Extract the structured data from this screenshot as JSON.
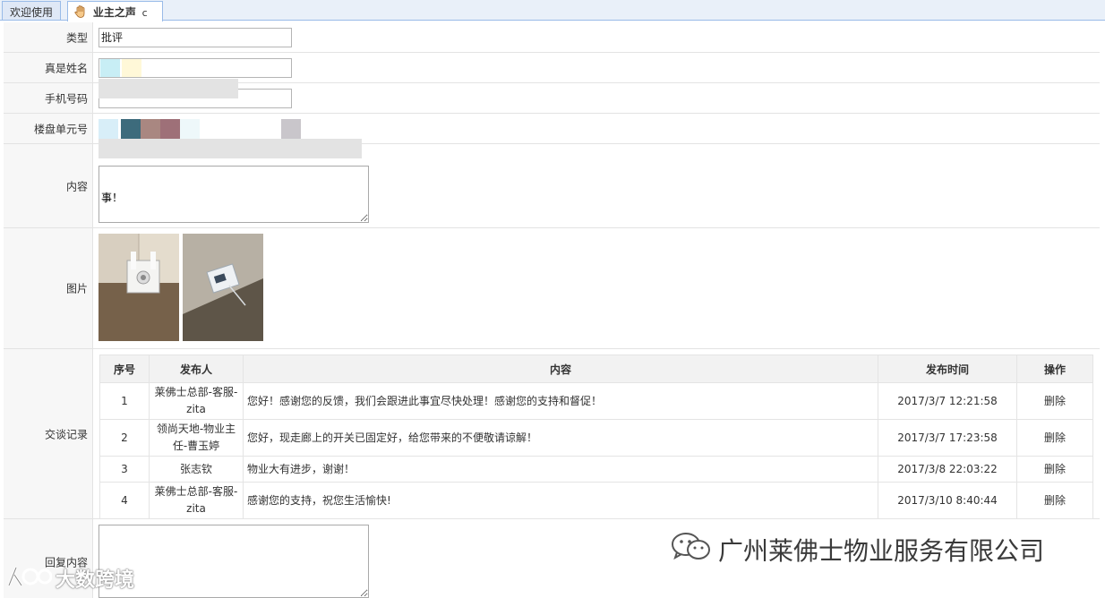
{
  "tabs": {
    "welcome": "欢迎使用",
    "current": "业主之声",
    "refresh": "c",
    "close": "×"
  },
  "form": {
    "type": {
      "label": "类型",
      "value": "批评"
    },
    "name": {
      "label": "真是姓名"
    },
    "phone": {
      "label": "手机号码"
    },
    "unit": {
      "label": "楼盘单元号"
    },
    "content": {
      "label": "内容",
      "value": "事！"
    },
    "images": {
      "label": "图片"
    },
    "records": {
      "label": "交谈记录"
    },
    "reply": {
      "label": "回复内容"
    }
  },
  "records": {
    "headers": [
      "序号",
      "发布人",
      "内容",
      "发布时间",
      "操作"
    ],
    "rows": [
      {
        "no": "1",
        "author": "莱佛士总部-客服-zita",
        "content": "您好！感谢您的反馈，我们会跟进此事宜尽快处理！感谢您的支持和督促！",
        "time": "2017/3/7 12:21:58",
        "action": "删除"
      },
      {
        "no": "2",
        "author": "领尚天地-物业主任-曹玉婷",
        "content": "您好，现走廊上的开关已固定好，给您带来的不便敬请谅解！",
        "time": "2017/3/7 17:23:58",
        "action": "删除"
      },
      {
        "no": "3",
        "author": "张志钦",
        "content": "物业大有进步，谢谢！",
        "time": "2017/3/8 22:03:22",
        "action": "删除"
      },
      {
        "no": "4",
        "author": "莱佛士总部-客服-zita",
        "content": "感谢您的支持，祝您生活愉快!",
        "time": "2017/3/10 8:40:44",
        "action": "删除"
      }
    ]
  },
  "watermarks": {
    "company": "广州莱佛士物业服务有限公司",
    "brand": "大数跨境"
  },
  "icons": {
    "tab_icon": "hand-icon",
    "wechat": "wechat-icon",
    "brand_logo": "brand-logo-icon"
  }
}
